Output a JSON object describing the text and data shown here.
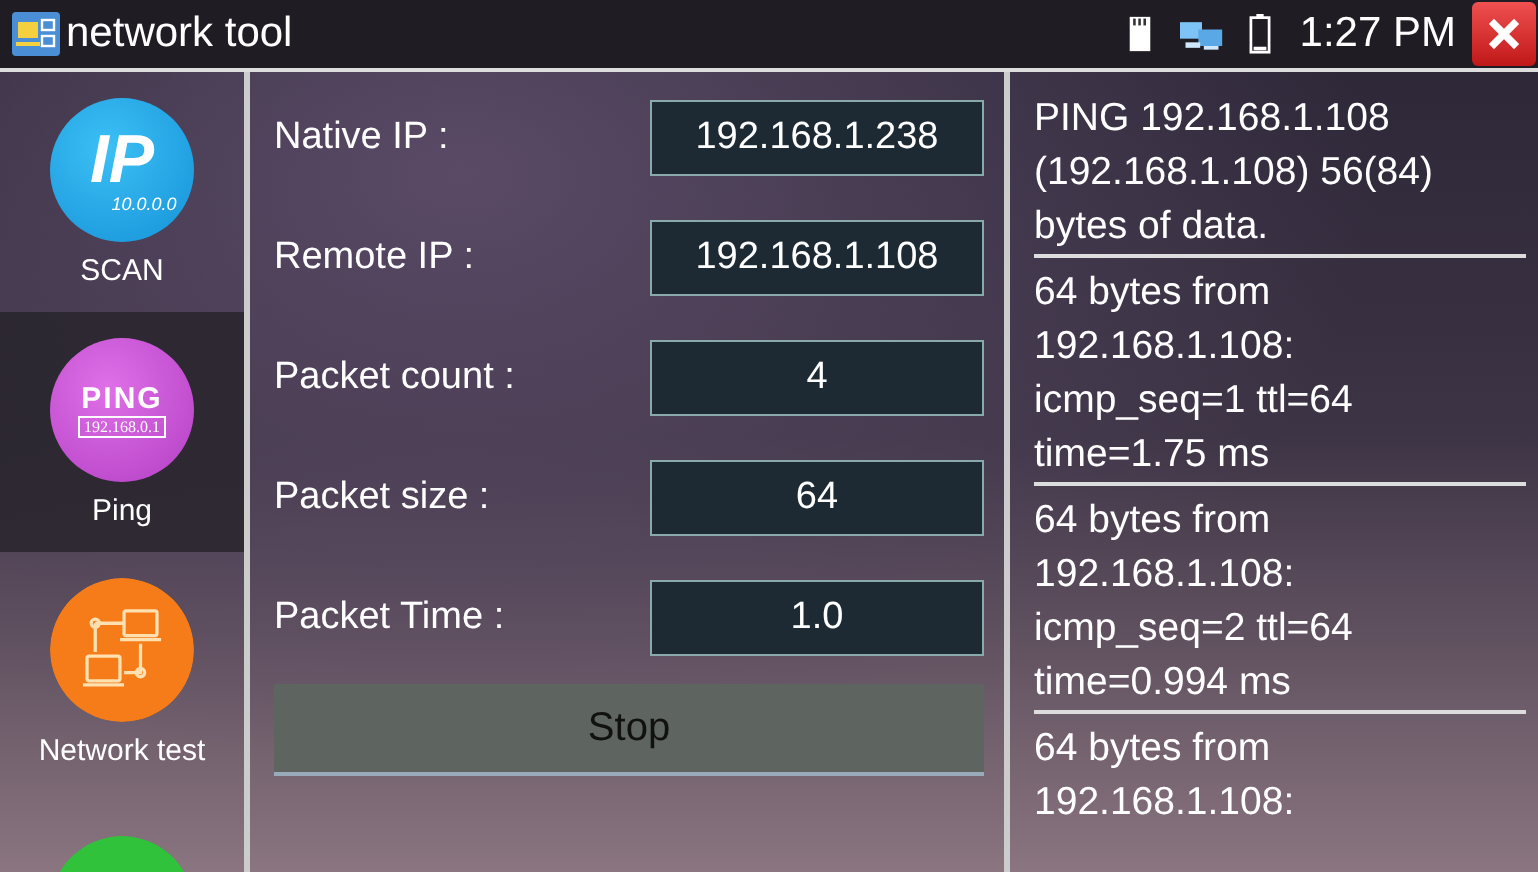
{
  "window": {
    "title": "network tool",
    "time": "1:27 PM"
  },
  "sidebar": {
    "items": [
      {
        "kind": "scan",
        "label": "SCAN",
        "icon_text": "IP",
        "icon_subtext": "10.0.0.0",
        "selected": false
      },
      {
        "kind": "ping",
        "label": "Ping",
        "icon_text": "PING",
        "icon_subtext": "192.168.0.1",
        "selected": true
      },
      {
        "kind": "network",
        "label": "Network test",
        "selected": false
      },
      {
        "kind": "partial",
        "selected": false
      }
    ]
  },
  "form": {
    "fields": [
      {
        "label": "Native IP :",
        "value": "192.168.1.238"
      },
      {
        "label": "Remote IP :",
        "value": "192.168.1.108"
      },
      {
        "label": "Packet count :",
        "value": "4"
      },
      {
        "label": "Packet size :",
        "value": "64"
      },
      {
        "label": "Packet Time :",
        "value": "1.0"
      }
    ],
    "button": "Stop"
  },
  "log": {
    "entries": [
      {
        "lines": [
          "PING 192.168.1.108",
          "(192.168.1.108) 56(84)",
          "bytes of data."
        ]
      },
      {
        "lines": [
          "64 bytes from",
          "192.168.1.108:",
          "icmp_seq=1 ttl=64",
          "time=1.75 ms"
        ]
      },
      {
        "lines": [
          "64 bytes from",
          "192.168.1.108:",
          "icmp_seq=2 ttl=64",
          "time=0.994 ms"
        ]
      },
      {
        "lines": [
          "64 bytes from",
          "192.168.1.108:"
        ]
      }
    ]
  }
}
